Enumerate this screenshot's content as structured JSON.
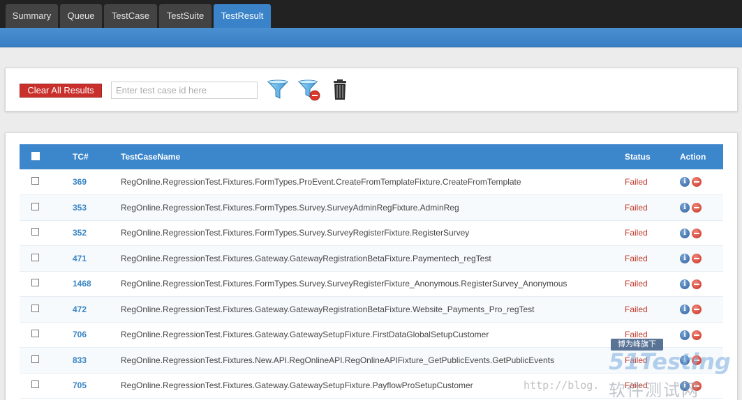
{
  "tabs": [
    {
      "label": "Summary",
      "active": false
    },
    {
      "label": "Queue",
      "active": false
    },
    {
      "label": "TestCase",
      "active": false
    },
    {
      "label": "TestSuite",
      "active": false
    },
    {
      "label": "TestResult",
      "active": true
    }
  ],
  "toolbar": {
    "clear_label": "Clear All Results",
    "search_placeholder": "Enter test case id here",
    "search_value": "",
    "icons": [
      "filter-icon",
      "clear-filter-icon",
      "trash-icon"
    ]
  },
  "table": {
    "headers": {
      "tc": "TC#",
      "name": "TestCaseName",
      "status": "Status",
      "action": "Action"
    },
    "rows": [
      {
        "tc": "369",
        "name": "RegOnline.RegressionTest.Fixtures.FormTypes.ProEvent.CreateFromTemplateFixture.CreateFromTemplate",
        "status": "Failed"
      },
      {
        "tc": "353",
        "name": "RegOnline.RegressionTest.Fixtures.FormTypes.Survey.SurveyAdminRegFixture.AdminReg",
        "status": "Failed"
      },
      {
        "tc": "352",
        "name": "RegOnline.RegressionTest.Fixtures.FormTypes.Survey.SurveyRegisterFixture.RegisterSurvey",
        "status": "Failed"
      },
      {
        "tc": "471",
        "name": "RegOnline.RegressionTest.Fixtures.Gateway.GatewayRegistrationBetaFixture.Paymentech_regTest",
        "status": "Failed"
      },
      {
        "tc": "1468",
        "name": "RegOnline.RegressionTest.Fixtures.FormTypes.Survey.SurveyRegisterFixture_Anonymous.RegisterSurvey_Anonymous",
        "status": "Failed"
      },
      {
        "tc": "472",
        "name": "RegOnline.RegressionTest.Fixtures.Gateway.GatewayRegistrationBetaFixture.Website_Payments_Pro_regTest",
        "status": "Failed"
      },
      {
        "tc": "706",
        "name": "RegOnline.RegressionTest.Fixtures.Gateway.GatewaySetupFixture.FirstDataGlobalSetupCustomer",
        "status": "Failed"
      },
      {
        "tc": "833",
        "name": "RegOnline.RegressionTest.Fixtures.New.API.RegOnlineAPI.RegOnlineAPIFixture_GetPublicEvents.GetPublicEvents",
        "status": "Failed"
      },
      {
        "tc": "705",
        "name": "RegOnline.RegressionTest.Fixtures.Gateway.GatewaySetupFixture.PayflowProSetupCustomer",
        "status": "Failed"
      }
    ]
  },
  "watermark": {
    "badge": "博为峰旗下",
    "logo": "51Testing",
    "cn": "软件测试网",
    "url": "http://blog."
  },
  "colors": {
    "accent": "#3a83c8",
    "danger": "#c9302c",
    "failed": "#c0392b",
    "tc_link": "#3a86c4"
  }
}
